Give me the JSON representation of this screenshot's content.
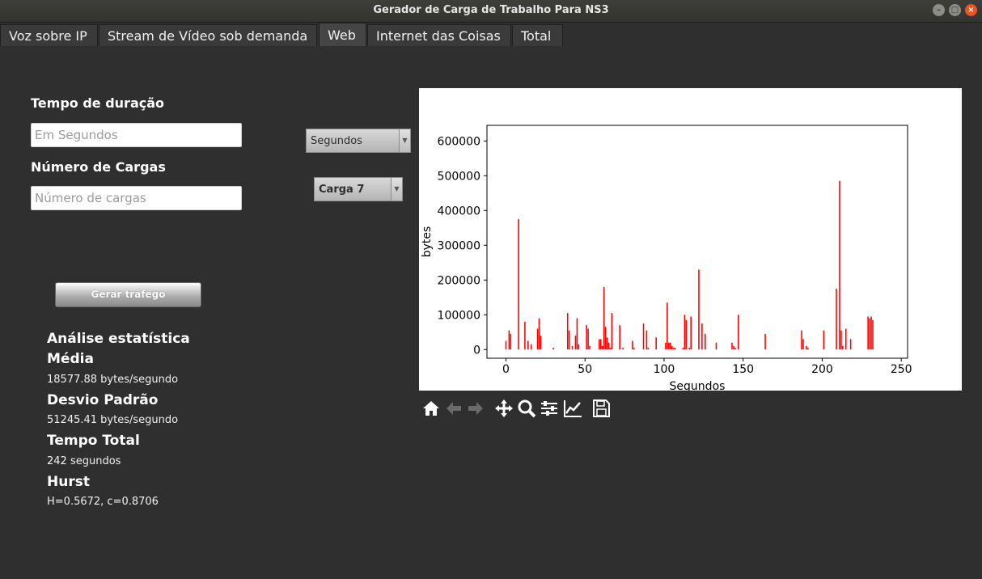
{
  "window": {
    "title": "Gerador de Carga de Trabalho Para NS3",
    "min_label": "–",
    "max_label": "□",
    "close_label": "×"
  },
  "tabs": [
    {
      "label": "Voz sobre IP"
    },
    {
      "label": "Stream de Vídeo sob demanda"
    },
    {
      "label": "Web",
      "active": true
    },
    {
      "label": "Internet das Coisas"
    },
    {
      "label": "Total"
    }
  ],
  "form": {
    "duration_label": "Tempo de duração",
    "duration_placeholder": "Em Segundos",
    "loads_label": "Número de Cargas",
    "loads_placeholder": "Número de cargas",
    "generate_button": "Gerar tráfego"
  },
  "controls": {
    "unit_select": "Segundos",
    "load_select": "Carga 7"
  },
  "stats": {
    "heading": "Análise estatística",
    "mean_label": "Média",
    "mean_value": "18577.88  bytes/segundo",
    "std_label": "Desvio Padrão",
    "std_value": "51245.41  bytes/segundo",
    "total_label": "Tempo Total",
    "total_value": "242 segundos",
    "hurst_label": "Hurst",
    "hurst_value": "H=0.5672, c=0.8706"
  },
  "chart_data": {
    "type": "bar",
    "xlabel": "Segundos",
    "ylabel": "bytes",
    "xlim": [
      -12,
      254
    ],
    "ylim": [
      -25000,
      645000
    ],
    "xticks": [
      0,
      50,
      100,
      150,
      200,
      250
    ],
    "yticks": [
      0,
      100000,
      200000,
      300000,
      400000,
      500000,
      600000
    ],
    "color": "#ff0000",
    "x": [
      0,
      2,
      3,
      8,
      12,
      14,
      16,
      20,
      21,
      22,
      30,
      39,
      40,
      42,
      44,
      45,
      46,
      51,
      52,
      53,
      59,
      60,
      61,
      62,
      63,
      64,
      65,
      66,
      67,
      72,
      74,
      80,
      81,
      87,
      89,
      90,
      95,
      101,
      102,
      103,
      104,
      105,
      106,
      107,
      112,
      113,
      114,
      116,
      117,
      122,
      124,
      126,
      133,
      143,
      144,
      145,
      147,
      164,
      187,
      188,
      190,
      191,
      201,
      209,
      211,
      212,
      213,
      215,
      218,
      229,
      230,
      231,
      232
    ],
    "values": [
      25000,
      55000,
      45000,
      375000,
      80000,
      25000,
      15000,
      60000,
      90000,
      40000,
      5000,
      105000,
      55000,
      10000,
      40000,
      90000,
      15000,
      70000,
      60000,
      10000,
      30000,
      30000,
      10000,
      180000,
      65000,
      35000,
      20000,
      5000,
      105000,
      70000,
      5000,
      25000,
      5000,
      75000,
      55000,
      5000,
      35000,
      20000,
      135000,
      20000,
      20000,
      10000,
      5000,
      5000,
      5000,
      100000,
      85000,
      5000,
      95000,
      230000,
      75000,
      45000,
      20000,
      20000,
      10000,
      5000,
      100000,
      45000,
      55000,
      30000,
      10000,
      5000,
      55000,
      175000,
      485000,
      55000,
      10000,
      60000,
      30000,
      95000,
      90000,
      95000,
      85000
    ]
  },
  "toolbar": [
    {
      "name": "home-icon"
    },
    {
      "name": "back-arrow-icon"
    },
    {
      "name": "forward-arrow-icon"
    },
    {
      "name": "pan-icon"
    },
    {
      "name": "zoom-icon"
    },
    {
      "name": "subplots-config-icon"
    },
    {
      "name": "edit-axes-icon"
    },
    {
      "name": "save-icon"
    }
  ]
}
